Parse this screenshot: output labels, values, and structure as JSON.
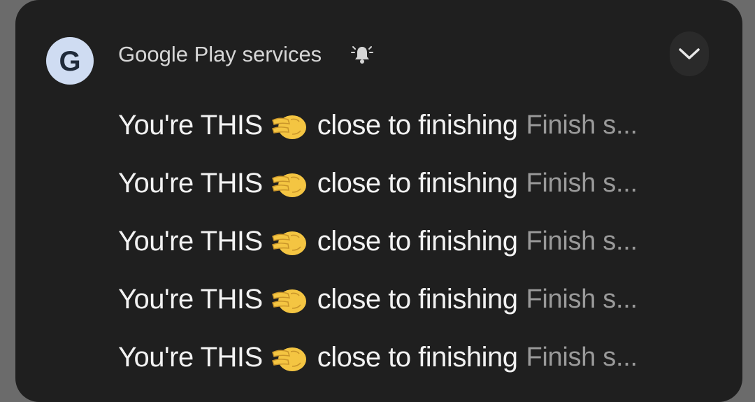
{
  "notification": {
    "app_icon_letter": "G",
    "app_name": "Google Play services",
    "icons": {
      "app": "google-play-services-icon",
      "alert": "bell-icon",
      "expand": "chevron-down-icon",
      "emoji": "pinching-hand-emoji-icon"
    },
    "colors": {
      "card_background": "#1f1f1f",
      "page_background": "#6b6b6b",
      "app_icon_background": "#cfdcf2",
      "title_text": "#f2f2f2",
      "preview_text": "#9a9a9a"
    },
    "messages": [
      {
        "title_start": "You're THIS",
        "title_end": "close to finishing",
        "preview": "Finish s..."
      },
      {
        "title_start": "You're THIS",
        "title_end": "close to finishing",
        "preview": "Finish s..."
      },
      {
        "title_start": "You're THIS",
        "title_end": "close to finishing",
        "preview": "Finish s..."
      },
      {
        "title_start": "You're THIS",
        "title_end": "close to finishing",
        "preview": "Finish s..."
      },
      {
        "title_start": "You're THIS",
        "title_end": "close to finishing",
        "preview": "Finish s..."
      }
    ]
  }
}
